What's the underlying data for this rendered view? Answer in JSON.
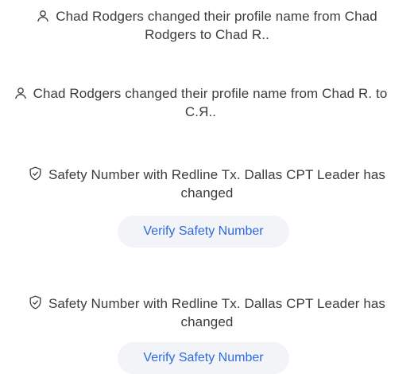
{
  "events": [
    {
      "icon": "person-icon",
      "line1": "Chad Rodgers changed their profile name from Chad",
      "line2": "Rodgers to Chad R.."
    },
    {
      "icon": "person-icon",
      "line1": "Chad Rodgers changed their profile name from Chad R. to",
      "line2": "C.Я.."
    },
    {
      "icon": "shield-check-icon",
      "line1": "Safety Number with Redline Tx. Dallas CPT Leader has",
      "line2": "changed",
      "button_label": "Verify Safety Number"
    },
    {
      "icon": "shield-check-icon",
      "line1": "Safety Number with Redline Tx. Dallas CPT Leader has",
      "line2": "changed",
      "button_label": "Verify Safety Number"
    }
  ],
  "colors": {
    "text": "#3c3c3c",
    "accent": "#2c6bdf",
    "button_bg": "#f2f4f7"
  }
}
